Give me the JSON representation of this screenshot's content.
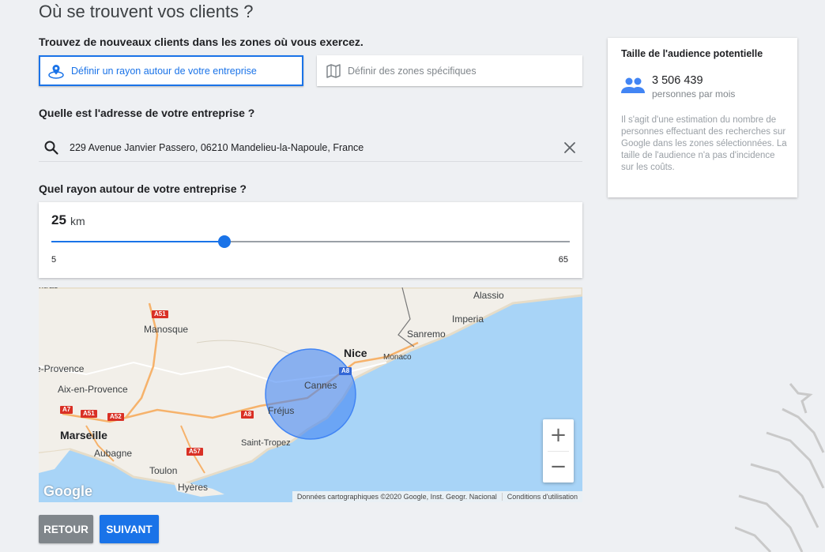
{
  "page": {
    "title": "Où se trouvent vos clients ?"
  },
  "zones": {
    "question": "Trouvez de nouveaux clients dans les zones où vous exercez.",
    "option_radius": "Définir un rayon autour de votre entreprise",
    "option_specific": "Définir des zones spécifiques",
    "selected": "option_radius"
  },
  "address": {
    "question": "Quelle est l'adresse de votre entreprise ?",
    "value": "229 Avenue Janvier Passero, 06210 Mandelieu-la-Napoule, France",
    "search_icon": "search-icon",
    "clear_icon": "close-icon"
  },
  "radius": {
    "question": "Quel rayon autour de votre entreprise ?",
    "value": "25",
    "unit": "km",
    "min": "5",
    "max": "65",
    "numeric_value": 25,
    "numeric_min": 5,
    "numeric_max": 65
  },
  "map": {
    "labels": [
      "Manosque",
      "Aix-en-Provence",
      "Marseille",
      "Aubagne",
      "Toulon",
      "Hyères",
      "Saint-Tropez",
      "Fréjus",
      "Cannes",
      "Nice",
      "Monaco",
      "Sanremo",
      "Imperia",
      "Alassio",
      "e-Provence",
      "ntras"
    ],
    "roads": [
      "A51",
      "A51",
      "A7",
      "A52",
      "A8",
      "A57",
      "A8"
    ],
    "logo": "Google",
    "attribution": "Données cartographiques ©2020 Google, Inst. Geogr. Nacional",
    "terms": "Conditions d'utilisation",
    "zoom_in": "+",
    "zoom_out": "−",
    "colors": {
      "sea": "#a8d4f7",
      "land": "#f2efe9",
      "radius_circle": "#4285f4"
    }
  },
  "audience": {
    "title": "Taille de l'audience potentielle",
    "number": "3 506 439",
    "unit": "personnes par mois",
    "description": "Il s'agit d'une estimation du nombre de personnes effectuant des recherches sur Google dans les zones sélectionnées. La taille de l'audience n'a pas d'incidence sur les coûts.",
    "icon": "people-icon"
  },
  "actions": {
    "back": "RETOUR",
    "next": "SUIVANT"
  },
  "theme": {
    "accent": "#1a73e8",
    "secondary": "#80868b",
    "background": "#eef0f3"
  }
}
